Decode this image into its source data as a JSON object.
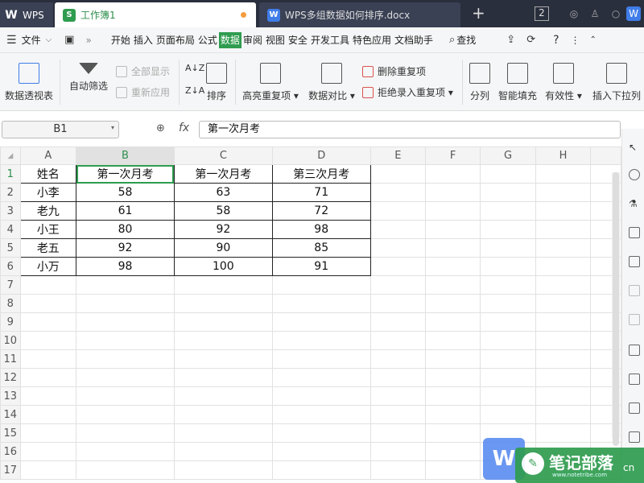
{
  "tabs": {
    "wps": "WPS",
    "workbook": "工作簿1",
    "doc": "WPS多组数据如何排序.docx",
    "new_tab": "+",
    "counter": "2"
  },
  "menu": {
    "file": "文件",
    "items": [
      "开始",
      "插入",
      "页面布局",
      "公式",
      "数据",
      "审阅",
      "视图",
      "安全",
      "开发工具",
      "特色应用",
      "文档助手"
    ],
    "active": "数据",
    "search": "查找",
    "help": "?"
  },
  "ribbon": {
    "pivot": "数据透视表",
    "autofilter": "自动筛选",
    "show_all": "全部显示",
    "reapply": "重新应用",
    "sort": "排序",
    "highlight_dup": "高亮重复项",
    "compare": "数据对比",
    "remove_dup": "删除重复项",
    "reject_dup": "拒绝录入重复项",
    "split": "分列",
    "smart_fill": "智能填充",
    "validity": "有效性",
    "insert_dropdown": "插入下拉列"
  },
  "formula_bar": {
    "cell_ref": "B1",
    "fx": "fx",
    "value": "第一次月考"
  },
  "sheet": {
    "columns": [
      "A",
      "B",
      "C",
      "D",
      "E",
      "F",
      "G",
      "H"
    ],
    "rows": [
      "1",
      "2",
      "3",
      "4",
      "5",
      "6",
      "7",
      "8",
      "9",
      "10",
      "11",
      "12",
      "13",
      "14",
      "15",
      "16",
      "17"
    ],
    "data": [
      [
        "姓名",
        "第一次月考",
        "第一次月考",
        "第三次月考"
      ],
      [
        "小李",
        "58",
        "63",
        "71"
      ],
      [
        "老九",
        "61",
        "58",
        "72"
      ],
      [
        "小王",
        "80",
        "92",
        "98"
      ],
      [
        "老五",
        "92",
        "90",
        "85"
      ],
      [
        "小万",
        "98",
        "100",
        "91"
      ]
    ]
  },
  "watermark": {
    "text": "笔记部落",
    "url": "www.notetribe.com",
    "suffix": "cn"
  },
  "colors": {
    "accent": "#2f9c4f",
    "tabbar": "#2a2f3d"
  }
}
